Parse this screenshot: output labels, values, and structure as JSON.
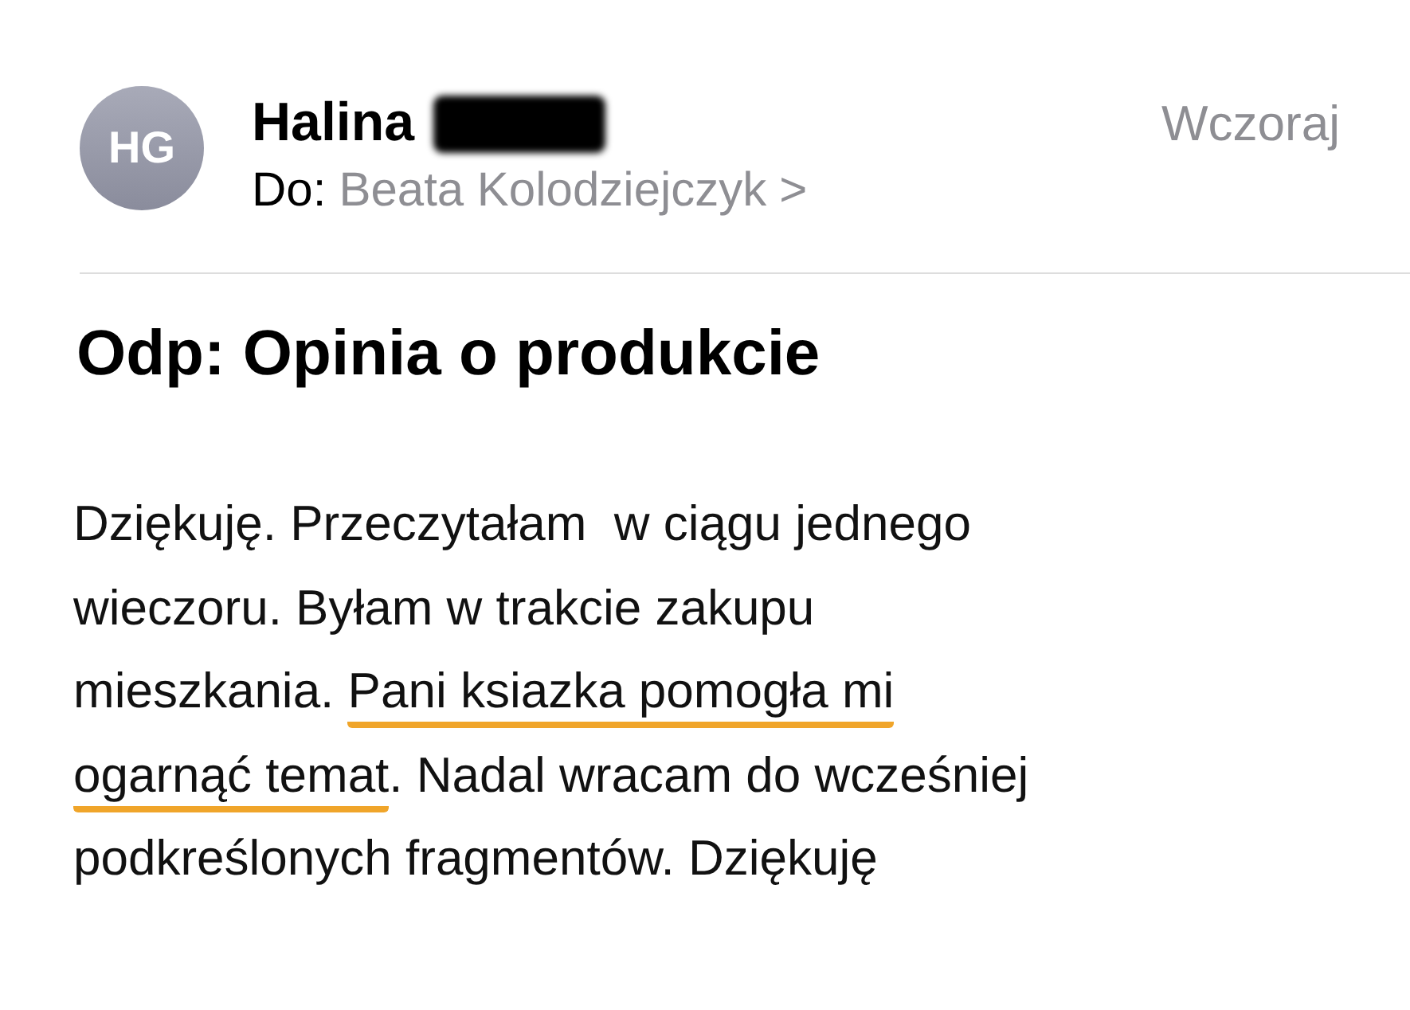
{
  "sender": {
    "initials": "HG",
    "name": "Halina",
    "name_redacted": true,
    "date": "Wczoraj"
  },
  "recipient": {
    "label": "Do:",
    "name": "Beata Kolodziejczyk",
    "chevron": ">"
  },
  "subject": "Odp: Opinia o produkcie",
  "body_lines": [
    [
      {
        "text": "Dziękuję. Przeczytałam  w ciągu jednego",
        "underlined": false
      }
    ],
    [
      {
        "text": "wieczoru. Byłam w trakcie zakupu",
        "underlined": false
      }
    ],
    [
      {
        "text": "mieszkania. ",
        "underlined": false
      },
      {
        "text": "Pani ksiazka pomogła mi",
        "underlined": true
      }
    ],
    [
      {
        "text": "ogarnąć temat",
        "underlined": true
      },
      {
        "text": ". Nadal wracam do wcześniej",
        "underlined": false
      }
    ],
    [
      {
        "text": "podkreślonych fragmentów. Dziękuję",
        "underlined": false
      }
    ]
  ]
}
